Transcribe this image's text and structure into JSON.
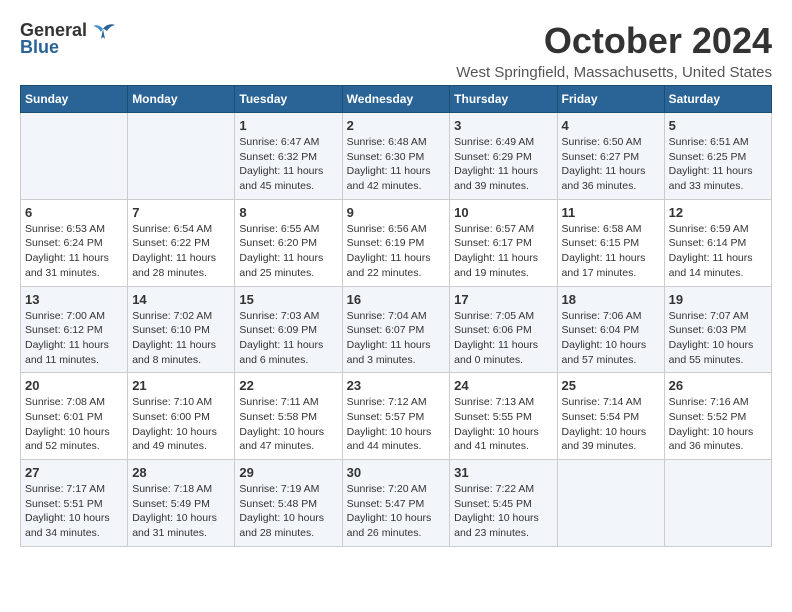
{
  "header": {
    "logo_general": "General",
    "logo_blue": "Blue",
    "month_title": "October 2024",
    "location": "West Springfield, Massachusetts, United States"
  },
  "weekdays": [
    "Sunday",
    "Monday",
    "Tuesday",
    "Wednesday",
    "Thursday",
    "Friday",
    "Saturday"
  ],
  "weeks": [
    [
      {
        "day": "",
        "text": ""
      },
      {
        "day": "",
        "text": ""
      },
      {
        "day": "1",
        "text": "Sunrise: 6:47 AM\nSunset: 6:32 PM\nDaylight: 11 hours and 45 minutes."
      },
      {
        "day": "2",
        "text": "Sunrise: 6:48 AM\nSunset: 6:30 PM\nDaylight: 11 hours and 42 minutes."
      },
      {
        "day": "3",
        "text": "Sunrise: 6:49 AM\nSunset: 6:29 PM\nDaylight: 11 hours and 39 minutes."
      },
      {
        "day": "4",
        "text": "Sunrise: 6:50 AM\nSunset: 6:27 PM\nDaylight: 11 hours and 36 minutes."
      },
      {
        "day": "5",
        "text": "Sunrise: 6:51 AM\nSunset: 6:25 PM\nDaylight: 11 hours and 33 minutes."
      }
    ],
    [
      {
        "day": "6",
        "text": "Sunrise: 6:53 AM\nSunset: 6:24 PM\nDaylight: 11 hours and 31 minutes."
      },
      {
        "day": "7",
        "text": "Sunrise: 6:54 AM\nSunset: 6:22 PM\nDaylight: 11 hours and 28 minutes."
      },
      {
        "day": "8",
        "text": "Sunrise: 6:55 AM\nSunset: 6:20 PM\nDaylight: 11 hours and 25 minutes."
      },
      {
        "day": "9",
        "text": "Sunrise: 6:56 AM\nSunset: 6:19 PM\nDaylight: 11 hours and 22 minutes."
      },
      {
        "day": "10",
        "text": "Sunrise: 6:57 AM\nSunset: 6:17 PM\nDaylight: 11 hours and 19 minutes."
      },
      {
        "day": "11",
        "text": "Sunrise: 6:58 AM\nSunset: 6:15 PM\nDaylight: 11 hours and 17 minutes."
      },
      {
        "day": "12",
        "text": "Sunrise: 6:59 AM\nSunset: 6:14 PM\nDaylight: 11 hours and 14 minutes."
      }
    ],
    [
      {
        "day": "13",
        "text": "Sunrise: 7:00 AM\nSunset: 6:12 PM\nDaylight: 11 hours and 11 minutes."
      },
      {
        "day": "14",
        "text": "Sunrise: 7:02 AM\nSunset: 6:10 PM\nDaylight: 11 hours and 8 minutes."
      },
      {
        "day": "15",
        "text": "Sunrise: 7:03 AM\nSunset: 6:09 PM\nDaylight: 11 hours and 6 minutes."
      },
      {
        "day": "16",
        "text": "Sunrise: 7:04 AM\nSunset: 6:07 PM\nDaylight: 11 hours and 3 minutes."
      },
      {
        "day": "17",
        "text": "Sunrise: 7:05 AM\nSunset: 6:06 PM\nDaylight: 11 hours and 0 minutes."
      },
      {
        "day": "18",
        "text": "Sunrise: 7:06 AM\nSunset: 6:04 PM\nDaylight: 10 hours and 57 minutes."
      },
      {
        "day": "19",
        "text": "Sunrise: 7:07 AM\nSunset: 6:03 PM\nDaylight: 10 hours and 55 minutes."
      }
    ],
    [
      {
        "day": "20",
        "text": "Sunrise: 7:08 AM\nSunset: 6:01 PM\nDaylight: 10 hours and 52 minutes."
      },
      {
        "day": "21",
        "text": "Sunrise: 7:10 AM\nSunset: 6:00 PM\nDaylight: 10 hours and 49 minutes."
      },
      {
        "day": "22",
        "text": "Sunrise: 7:11 AM\nSunset: 5:58 PM\nDaylight: 10 hours and 47 minutes."
      },
      {
        "day": "23",
        "text": "Sunrise: 7:12 AM\nSunset: 5:57 PM\nDaylight: 10 hours and 44 minutes."
      },
      {
        "day": "24",
        "text": "Sunrise: 7:13 AM\nSunset: 5:55 PM\nDaylight: 10 hours and 41 minutes."
      },
      {
        "day": "25",
        "text": "Sunrise: 7:14 AM\nSunset: 5:54 PM\nDaylight: 10 hours and 39 minutes."
      },
      {
        "day": "26",
        "text": "Sunrise: 7:16 AM\nSunset: 5:52 PM\nDaylight: 10 hours and 36 minutes."
      }
    ],
    [
      {
        "day": "27",
        "text": "Sunrise: 7:17 AM\nSunset: 5:51 PM\nDaylight: 10 hours and 34 minutes."
      },
      {
        "day": "28",
        "text": "Sunrise: 7:18 AM\nSunset: 5:49 PM\nDaylight: 10 hours and 31 minutes."
      },
      {
        "day": "29",
        "text": "Sunrise: 7:19 AM\nSunset: 5:48 PM\nDaylight: 10 hours and 28 minutes."
      },
      {
        "day": "30",
        "text": "Sunrise: 7:20 AM\nSunset: 5:47 PM\nDaylight: 10 hours and 26 minutes."
      },
      {
        "day": "31",
        "text": "Sunrise: 7:22 AM\nSunset: 5:45 PM\nDaylight: 10 hours and 23 minutes."
      },
      {
        "day": "",
        "text": ""
      },
      {
        "day": "",
        "text": ""
      }
    ]
  ]
}
